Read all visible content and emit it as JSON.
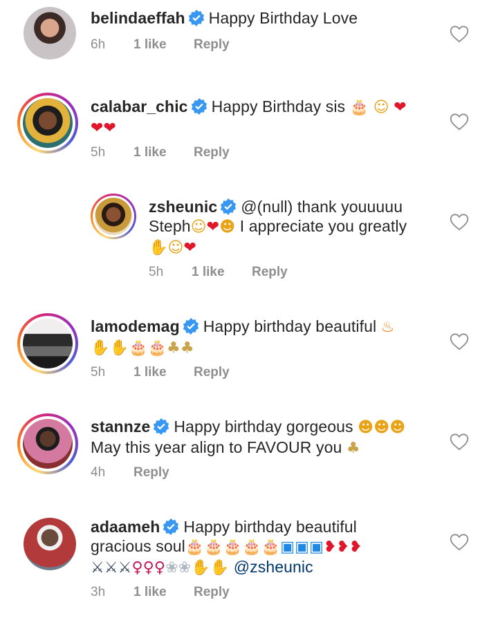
{
  "comments": [
    {
      "username": "belindaeffah",
      "text_parts": [
        "Happy Birthday Love"
      ],
      "time": "6h",
      "likes": "1 like",
      "reply": "Reply"
    },
    {
      "username": "calabar_chic",
      "text_parts": [
        "Happy Birthday sis"
      ],
      "time": "5h",
      "likes": "1 like",
      "reply": "Reply"
    },
    {
      "username": "zsheunic",
      "text_parts": [
        "@(null) thank youuuuu",
        "Steph",
        "I appreciate you greatly"
      ],
      "time": "5h",
      "likes": "1 like",
      "reply": "Reply"
    },
    {
      "username": "lamodemag",
      "text_parts": [
        "Happy birthday beautiful"
      ],
      "time": "5h",
      "likes": "1 like",
      "reply": "Reply"
    },
    {
      "username": "stannze",
      "text_parts": [
        "Happy birthday gorgeous",
        "May this year align to FAVOUR you"
      ],
      "time": "4h",
      "reply": "Reply"
    },
    {
      "username": "adaameh",
      "text_parts": [
        "Happy birthday beautiful",
        "gracious soul",
        "@zsheunic"
      ],
      "time": "3h",
      "likes": "1 like",
      "reply": "Reply"
    }
  ],
  "icons": {
    "verified": "verified-badge-icon",
    "like": "heart-outline-icon"
  },
  "colors": {
    "verified_blue": "#3897f0",
    "muted_text": "#8e8e8e",
    "mention": "#00376b"
  }
}
